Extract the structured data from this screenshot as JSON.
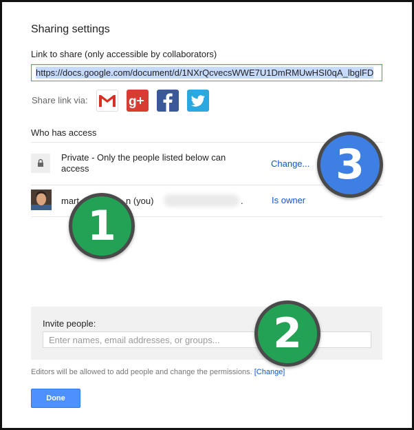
{
  "dialog": {
    "title": "Sharing settings",
    "link_label": "Link to share (only accessible by collaborators)",
    "link_value": "https://docs.google.com/document/d/1NXrQcvecsWWE7U1DmRMUwHSI0qA_lbglFD",
    "share_via_label": "Share link via:",
    "social_buttons": [
      {
        "icon": "gmail-icon",
        "color": "#d93025"
      },
      {
        "icon": "google-plus-icon",
        "color": "#d73d32"
      },
      {
        "icon": "facebook-icon",
        "color": "#3b5998"
      },
      {
        "icon": "twitter-icon",
        "color": "#2aa9e0"
      }
    ],
    "who_has_access": "Who has access",
    "access_rows": [
      {
        "icon": "lock-icon",
        "text": "Private - Only the people listed below can access",
        "action": "Change..."
      },
      {
        "icon": "avatar",
        "name": "mart",
        "name_suffix": "n (you)",
        "role": "Is owner"
      }
    ],
    "invite": {
      "label": "Invite people:",
      "placeholder": "Enter names, email addresses, or groups..."
    },
    "permissions_note": "Editors will be allowed to add people and change the permissions.",
    "permissions_change": "[Change]",
    "done_label": "Done",
    "accent_color": "#4d90fe",
    "link_color": "#1155cc"
  },
  "annotations": {
    "badge_1": "1",
    "badge_2": "2",
    "badge_3": "3",
    "badge_green": "#23a256",
    "badge_blue": "#3e7fe4"
  }
}
